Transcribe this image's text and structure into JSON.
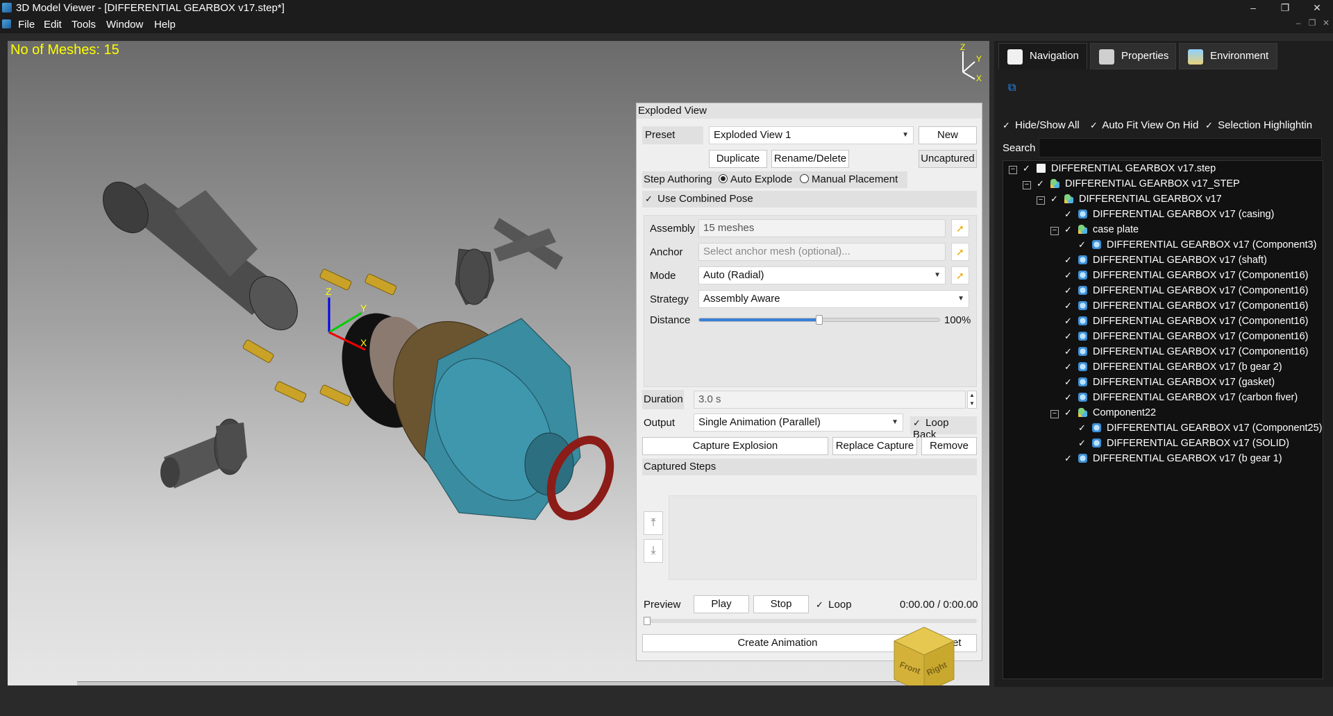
{
  "window": {
    "title": "3D Model Viewer - [DIFFERENTIAL GEARBOX v17.step*]",
    "app_icon": "cube-app-icon",
    "controls": {
      "minimize": "–",
      "maximize": "❐",
      "close": "✕"
    }
  },
  "menu": {
    "items": [
      "File",
      "Edit",
      "Tools",
      "Window",
      "Help"
    ],
    "mdi": {
      "minimize": "–",
      "restore": "❐",
      "close": "✕"
    }
  },
  "viewport": {
    "mesh_count": "No of Meshes: 15",
    "axis_labels": {
      "x": "X",
      "y": "Y",
      "z": "Z"
    },
    "nav_cube": {
      "front": "Front",
      "right": "Right"
    }
  },
  "exploded_view": {
    "title": "Exploded View",
    "preset_label": "Preset",
    "preset_value": "Exploded View 1",
    "new_button": "New",
    "duplicate_button": "Duplicate",
    "rename_delete_button": "Rename/Delete",
    "uncaptured_button": "Uncaptured",
    "step_authoring_label": "Step Authoring",
    "auto_explode_label": "Auto Explode",
    "manual_placement_label": "Manual Placement",
    "use_combined_pose_label": "Use Combined Pose",
    "assembly_label": "Assembly",
    "assembly_value": "15 meshes",
    "anchor_label": "Anchor",
    "anchor_placeholder": "Select anchor mesh (optional)...",
    "mode_label": "Mode",
    "mode_value": "Auto (Radial)",
    "strategy_label": "Strategy",
    "strategy_value": "Assembly Aware",
    "distance_label": "Distance",
    "distance_value": "100%",
    "distance_fraction": 0.5,
    "duration_label": "Duration",
    "duration_value": "3.0 s",
    "output_label": "Output",
    "output_value": "Single Animation (Parallel)",
    "loop_back_label": "Loop Back",
    "capture_explosion_button": "Capture Explosion",
    "replace_capture_button": "Replace Capture",
    "remove_button": "Remove",
    "captured_steps_label": "Captured Steps",
    "preview_label": "Preview",
    "play_button": "Play",
    "stop_button": "Stop",
    "loop_label": "Loop",
    "time_readout": "0:00.00 / 0:00.00",
    "create_animation_button": "Create Animation",
    "reset_button": "Reset"
  },
  "right_panel": {
    "tabs": [
      "Navigation",
      "Properties",
      "Environment"
    ],
    "hide_show_all": "Hide/Show All",
    "auto_fit_view": "Auto Fit View On Hid",
    "selection_highlighting": "Selection Highlightin",
    "search_label": "Search",
    "tree": [
      "DIFFERENTIAL GEARBOX v17.step",
      "DIFFERENTIAL GEARBOX v17_STEP",
      "DIFFERENTIAL GEARBOX v17",
      "DIFFERENTIAL GEARBOX v17 (casing)",
      "case plate",
      "DIFFERENTIAL GEARBOX v17 (Component3)",
      "DIFFERENTIAL GEARBOX v17 (shaft)",
      "DIFFERENTIAL GEARBOX v17 (Component16)",
      "DIFFERENTIAL GEARBOX v17 (Component16)",
      "DIFFERENTIAL GEARBOX v17 (Component16)",
      "DIFFERENTIAL GEARBOX v17 (Component16)",
      "DIFFERENTIAL GEARBOX v17 (Component16)",
      "DIFFERENTIAL GEARBOX v17 (Component16)",
      "DIFFERENTIAL GEARBOX v17 (b gear 2)",
      "DIFFERENTIAL GEARBOX v17 (gasket)",
      "DIFFERENTIAL GEARBOX v17 (carbon fiver)",
      "Component22",
      "DIFFERENTIAL GEARBOX v17 (Component25)",
      "DIFFERENTIAL GEARBOX v17 (SOLID)",
      "DIFFERENTIAL GEARBOX v17 (b gear 1)"
    ]
  }
}
